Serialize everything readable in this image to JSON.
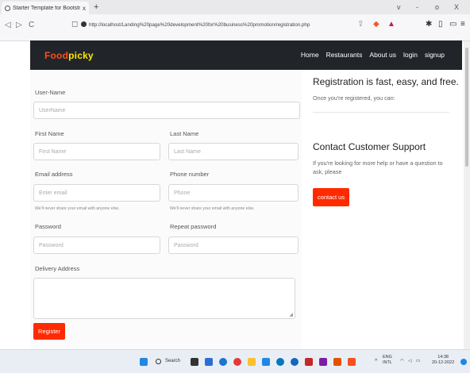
{
  "browser": {
    "tab_title": "Starter Template for Bootstrap",
    "tab_close": "x",
    "new_tab": "+",
    "window_controls": [
      "v",
      "-",
      "o",
      "X"
    ],
    "url": "http://localhost/Landing%20page%20development%20for%20business%20promotion/registration.php",
    "nav_glyphs": [
      "◁",
      "▷",
      "C"
    ]
  },
  "site": {
    "brand_part1": "Food",
    "brand_part2": "picky",
    "nav": [
      "Home",
      "Restaurants",
      "About us",
      "login",
      "signup"
    ]
  },
  "form": {
    "username": {
      "label": "User-Name",
      "placeholder": "UserName"
    },
    "first_name": {
      "label": "First Name",
      "placeholder": "First Name"
    },
    "last_name": {
      "label": "Last Name",
      "placeholder": "Last Name"
    },
    "email": {
      "label": "Email address",
      "placeholder": "Enter email",
      "help": "We'll never share your email with anyone else."
    },
    "phone": {
      "label": "Phone number",
      "placeholder": "Phone",
      "help": "We'll never share your email with anyone else."
    },
    "password": {
      "label": "Password",
      "placeholder": "Password"
    },
    "repeat_password": {
      "label": "Repeat password",
      "placeholder": "Password"
    },
    "address": {
      "label": "Delivery Address"
    },
    "register_label": "Register"
  },
  "sidebar": {
    "heading": "Registration is fast, easy, and free.",
    "subtext": "Once you're registered, you can:",
    "support_heading": "Contact Customer Support",
    "support_text": "If you're looking for more help or have a question to ask, please",
    "contact_label": "contact us"
  },
  "taskbar": {
    "search_label": "Search",
    "lang": "ENG",
    "lang_sub": "INTL",
    "time": "14:38",
    "date": "20-12-2022"
  },
  "colors": {
    "accent": "#ff2a00",
    "navbar": "#212529",
    "brand_food": "#ff4d1a",
    "brand_picky": "#ffe600"
  }
}
